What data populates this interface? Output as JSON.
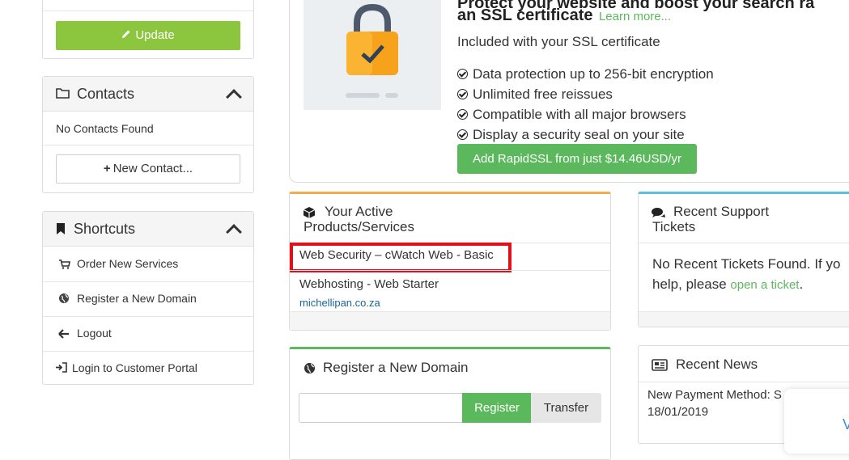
{
  "left": {
    "update_label": "Update",
    "contacts": {
      "title": "Contacts",
      "empty_text": "No Contacts Found",
      "new_contact_label": "New Contact..."
    },
    "shortcuts": {
      "title": "Shortcuts",
      "items": [
        {
          "label": "Order New Services",
          "icon": "cart-icon"
        },
        {
          "label": "Register a New Domain",
          "icon": "globe-icon"
        },
        {
          "label": "Logout",
          "icon": "arrow-left-icon"
        },
        {
          "label": "Login to Customer Portal",
          "icon": "sign-in-icon"
        }
      ]
    }
  },
  "ssl_promo": {
    "title_line1": "Protect your website and boost your search ra",
    "title_line2": "an SSL certificate",
    "learn_more": "Learn more...",
    "included": "Included with your SSL certificate",
    "features": [
      "Data protection up to 256-bit encryption",
      "Unlimited free reissues",
      "Compatible with all major browsers",
      "Display a security seal on your site"
    ],
    "button_label": "Add RapidSSL from just $14.46USD/yr"
  },
  "active_products": {
    "title_line1": "Your Active",
    "title_line2": "Products/Services",
    "items": [
      {
        "name": "Web Security – cWatch Web - Basic",
        "domain": ""
      },
      {
        "name": "Webhosting - Web Starter",
        "domain": "michellipan.co.za"
      }
    ]
  },
  "support_tickets": {
    "title_line1": "Recent Support",
    "title_line2": "Tickets",
    "text_line1": "No Recent Tickets Found. If yo",
    "text_line2_pre": "help, please ",
    "text_link": "open a ticket",
    "text_line2_post": "."
  },
  "register_domain": {
    "title": "Register a New Domain",
    "input_value": "",
    "register_label": "Register",
    "transfer_label": "Transfer"
  },
  "news": {
    "title": "Recent News",
    "item_title": "New Payment Method: S",
    "item_date": "18/01/2019"
  },
  "colors": {
    "green": "#8cc63f",
    "green_dark": "#5cb85c",
    "orange_border": "#f0ad4e",
    "teal_border": "#5bc0de",
    "highlight_red": "#e3101c"
  }
}
